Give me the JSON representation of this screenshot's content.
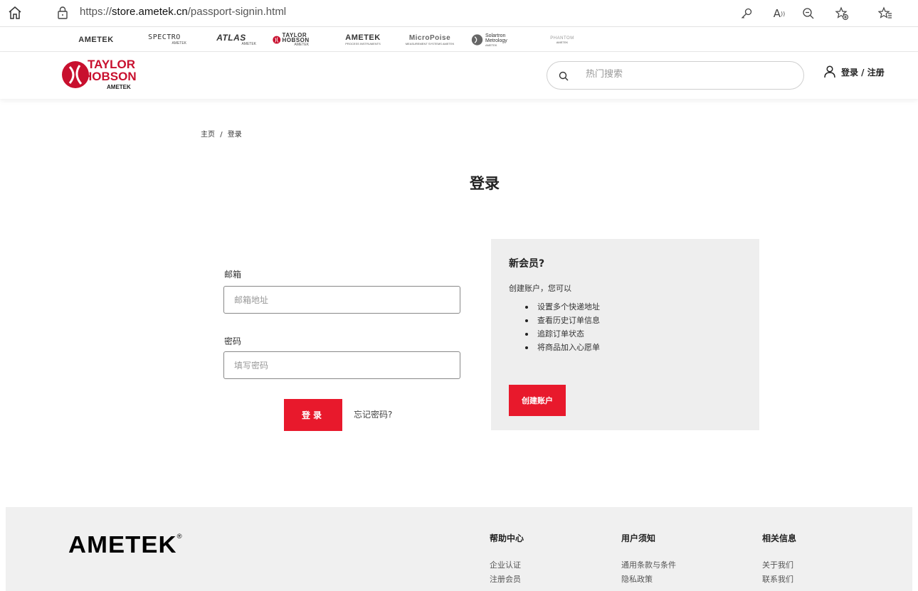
{
  "browser": {
    "url_scheme": "https://",
    "url_host": "store.ametek.cn",
    "url_path": "/passport-signin.html",
    "icons": [
      "home-icon",
      "lock-icon",
      "key-icon",
      "read-aloud-icon",
      "zoom-out-icon",
      "favorite-add-icon",
      "favorites-icon"
    ]
  },
  "brands": [
    {
      "name": "AMETEK",
      "sub": ""
    },
    {
      "name": "SPECTRO",
      "sub": "AMETEK"
    },
    {
      "name": "ATLAS",
      "sub": "AMETEK"
    },
    {
      "name": "TAYLOR HOBSON",
      "sub": "AMETEK"
    },
    {
      "name": "AMETEK",
      "sub": "PROCESS INSTRUMENTS"
    },
    {
      "name": "MicroPoise",
      "sub": "MEASUREMENT SYSTEMS AMETEK"
    },
    {
      "name": "Solartron Metrology",
      "sub": "AMETEK"
    },
    {
      "name": "PHANTOM",
      "sub": "AMETEK"
    }
  ],
  "header": {
    "logo_line1": "TAYLOR",
    "logo_line2": "HOBSON",
    "logo_line3": "AMETEK",
    "search_placeholder": "热门搜索",
    "login_register": "登录 / 注册"
  },
  "breadcrumb": {
    "home": "主页",
    "separator": "/",
    "current": "登录"
  },
  "page_title": "登录",
  "form": {
    "email_label": "邮箱",
    "email_placeholder": "邮箱地址",
    "password_label": "密码",
    "password_placeholder": "填写密码",
    "login_button": "登录",
    "forgot_link": "忘记密码?"
  },
  "member_box": {
    "title": "新会员?",
    "subtitle": "创建账户，您可以",
    "benefits": [
      "设置多个快递地址",
      "查看历史订单信息",
      "追踪订单状态",
      "将商品加入心愿单"
    ],
    "create_button": "创建账户"
  },
  "footer": {
    "logo": "AMETEK",
    "logo_mark": "®",
    "columns": [
      {
        "heading": "帮助中心",
        "links": [
          "企业认证",
          "注册会员"
        ]
      },
      {
        "heading": "用户须知",
        "links": [
          "通用条款与条件",
          "隐私政策"
        ]
      },
      {
        "heading": "相关信息",
        "links": [
          "关于我们",
          "联系我们"
        ]
      }
    ]
  },
  "colors": {
    "brand_red": "#e8192c",
    "panel_gray": "#eeeeee",
    "footer_gray": "#f0f0f0"
  }
}
